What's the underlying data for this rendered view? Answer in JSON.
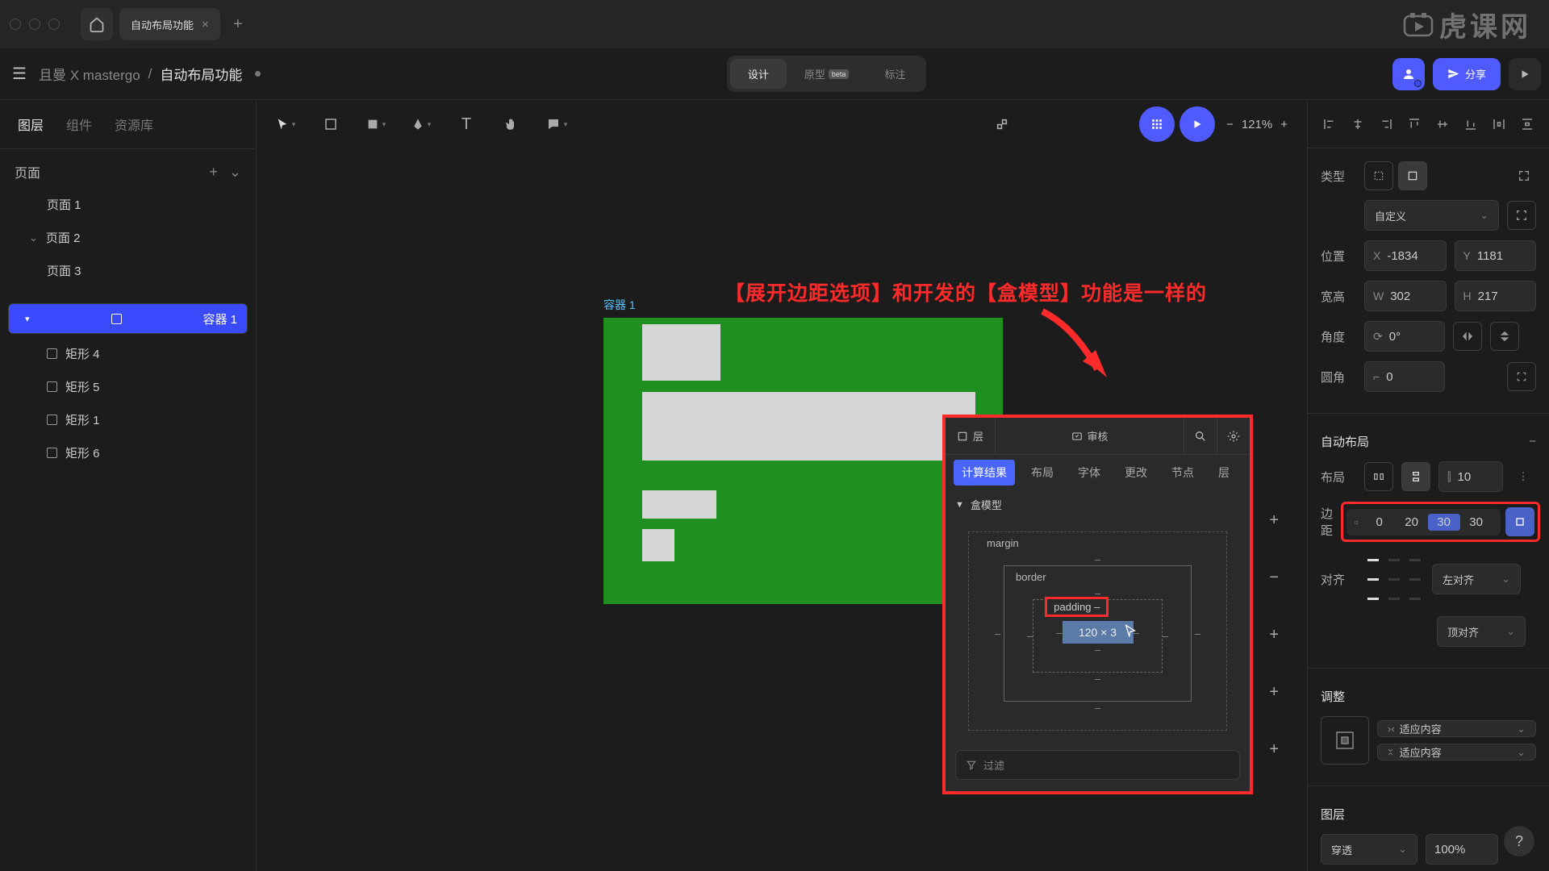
{
  "tab": {
    "title": "自动布局功能"
  },
  "breadcrumb": {
    "project": "且曼 X mastergo",
    "file": "自动布局功能"
  },
  "modes": {
    "design": "设计",
    "prototype": "原型",
    "beta": "beta",
    "annotate": "标注"
  },
  "share": {
    "share": "分享"
  },
  "zoom": {
    "level": "121%"
  },
  "leftTabs": {
    "layers": "图层",
    "components": "组件",
    "resources": "资源库"
  },
  "pages": {
    "title": "页面",
    "items": [
      "页面 1",
      "页面 2",
      "页面 3"
    ]
  },
  "layers": {
    "selected": "容器 1",
    "children": [
      "矩形 4",
      "矩形 5",
      "矩形 1",
      "矩形 6"
    ]
  },
  "canvas": {
    "containerLabel": "容器 1"
  },
  "annotation": {
    "text": "【展开边距选项】和开发的【盒模型】功能是一样的"
  },
  "dev": {
    "layer": "层",
    "review": "审核",
    "tabs": {
      "result": "计算结果",
      "layout": "布局",
      "font": "字体",
      "change": "更改",
      "node": "节点",
      "layer2": "层"
    },
    "boxmodel": "盒模型",
    "margin": "margin",
    "border": "border",
    "padding": "padding",
    "content": "120 × 3",
    "filter": "过滤"
  },
  "props": {
    "type": "类型",
    "custom": "自定义",
    "position": "位置",
    "x": "-1834",
    "y": "1181",
    "size": "宽高",
    "w": "302",
    "h": "217",
    "angle": "角度",
    "deg": "0°",
    "radius": "圆角",
    "r": "0",
    "autolayout": "自动布局",
    "layout": "布局",
    "gap": "10",
    "paddingLabel": "边距",
    "p": [
      "0",
      "20",
      "30",
      "30"
    ],
    "align": "对齐",
    "left": "左对齐",
    "top": "顶对齐",
    "adjust": "调整",
    "fitContent": "适应内容",
    "layerSection": "图层",
    "blend": "穿透",
    "opacity": "100%"
  },
  "watermark": {
    "text": "虎课网"
  }
}
